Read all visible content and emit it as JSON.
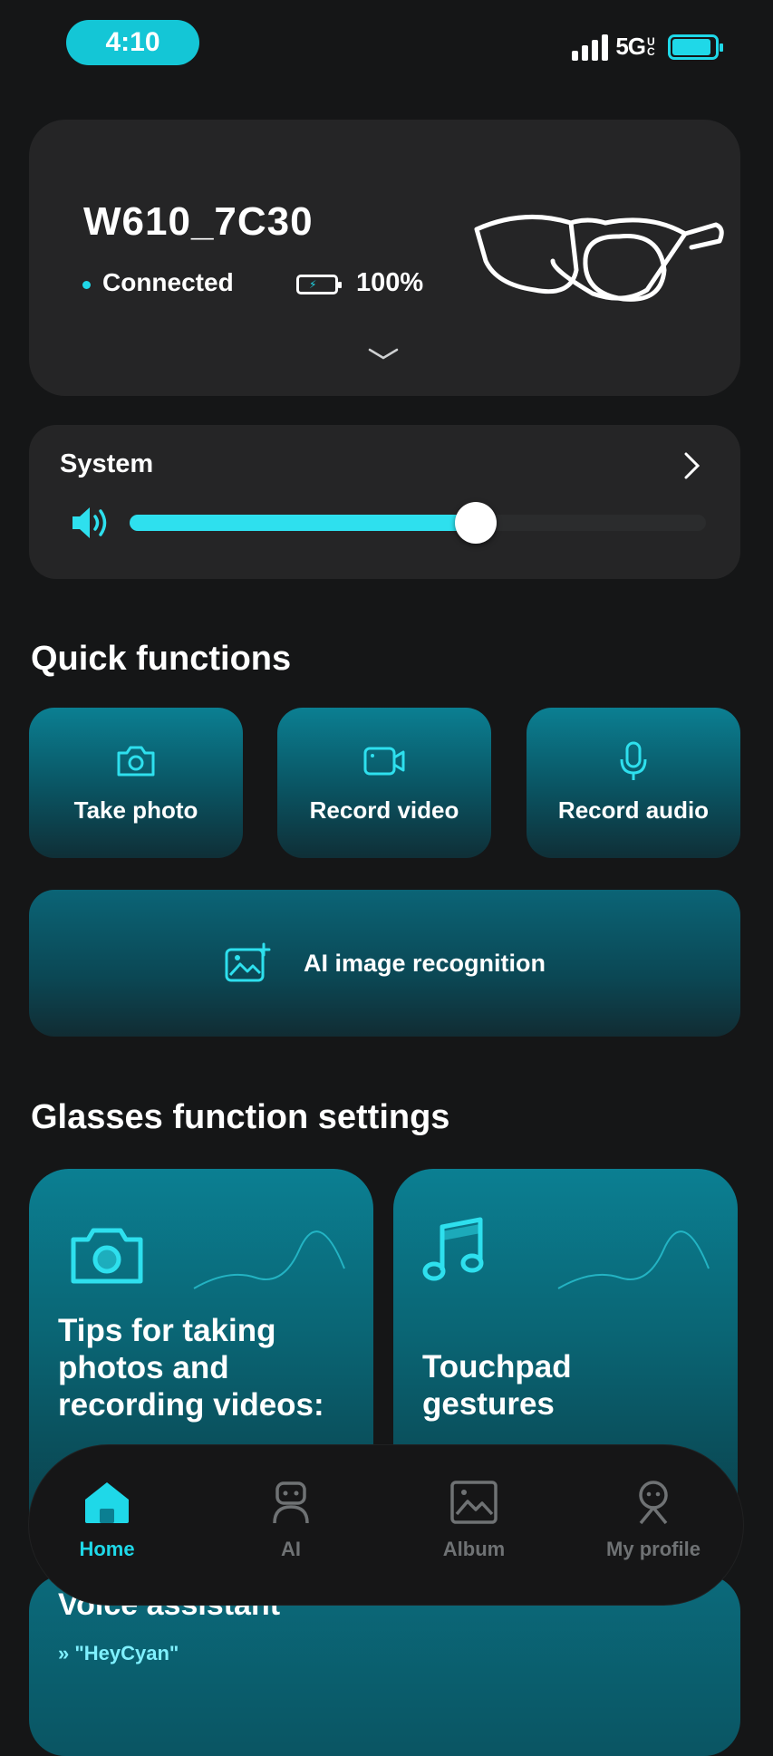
{
  "status_bar": {
    "time": "4:10",
    "network": "5G",
    "network_sub": "UC"
  },
  "device": {
    "name": "W610_7C30",
    "connection": "Connected",
    "battery": "100%"
  },
  "system": {
    "label": "System",
    "volume_level": 0.6
  },
  "quick_functions": {
    "title": "Quick functions",
    "buttons": [
      {
        "label": "Take photo",
        "icon": "camera-icon"
      },
      {
        "label": "Record video",
        "icon": "video-camera-icon"
      },
      {
        "label": "Record audio",
        "icon": "microphone-icon"
      }
    ],
    "ai": {
      "label": "AI image recognition",
      "icon": "image-sparkle-icon"
    }
  },
  "glasses_settings": {
    "title": "Glasses function settings",
    "cards": [
      {
        "title": "Tips for taking photos and recording videos:",
        "icon": "camera-icon"
      },
      {
        "title": "Touchpad gestures",
        "icon": "music-note-icon"
      }
    ],
    "voice": {
      "title": "Voice assistant",
      "command": "» \"HeyCyan\""
    }
  },
  "nav": {
    "items": [
      {
        "label": "Home",
        "icon": "home-icon",
        "active": true
      },
      {
        "label": "AI",
        "icon": "robot-icon",
        "active": false
      },
      {
        "label": "Album",
        "icon": "picture-icon",
        "active": false
      },
      {
        "label": "My profile",
        "icon": "profile-icon",
        "active": false
      }
    ]
  },
  "colors": {
    "accent": "#1fd8e8",
    "background": "#151617",
    "card": "#252526",
    "teal": "#0b7f92"
  }
}
